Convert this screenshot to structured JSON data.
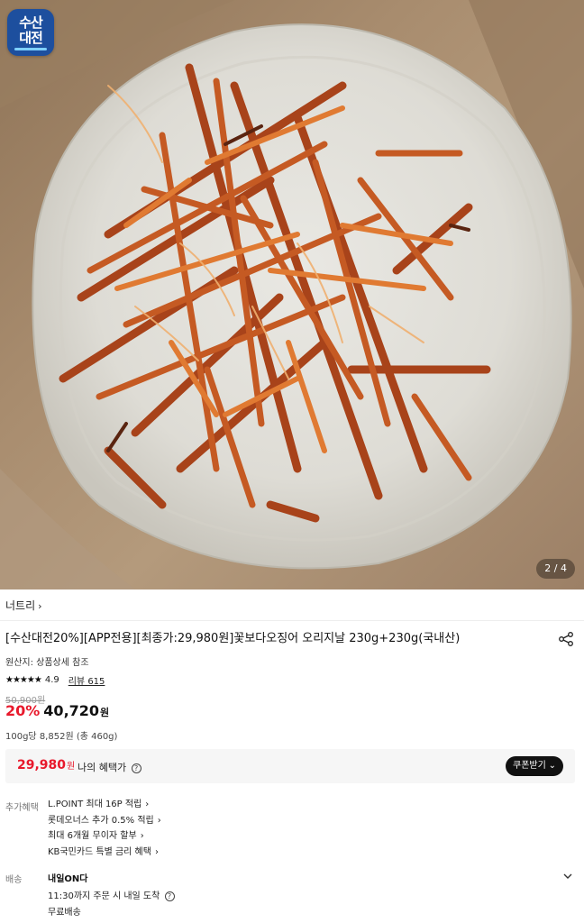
{
  "hero": {
    "badge_line1": "수산",
    "badge_line2": "대전",
    "pager": "2 / 4"
  },
  "product": {
    "brand": "너트리",
    "title": "[수산대전20%][APP전용][최종가:29,980원]꽃보다오징어 오리지날 230g+230g(국내산)",
    "origin": "원산지: 상품상세 참조",
    "stars": "★★★★★",
    "rating": "4.9",
    "reviews": "리뷰 615",
    "original_price": "50,900원",
    "discount": "20%",
    "price": "40,720",
    "price_unit": "원",
    "unit_price": "100g당 8,852원 (총 460g)"
  },
  "benefit": {
    "price": "29,980",
    "price_unit": "원",
    "label": "나의 혜택가",
    "coupon_button": "쿠폰받기"
  },
  "extra": {
    "label": "추가혜택",
    "items": [
      "L.POINT 최대 16P 적립",
      "롯데오너스 추가 0.5% 적립",
      "최대 6개월 무이자 할부",
      "KB국민카드 특별 금리 혜택"
    ]
  },
  "shipping": {
    "label": "배송",
    "title": "내일ON다",
    "time": "11:30까지 주문 시 내일 도착",
    "fee": "무료배송"
  },
  "colors": {
    "discount_red": "#e8192c",
    "badge_blue": "#1d4f9e",
    "coupon_black": "#111111"
  },
  "icons": [
    "share-icon",
    "info-icon",
    "chevron-down-icon",
    "chevron-right-icon",
    "star-icon"
  ]
}
